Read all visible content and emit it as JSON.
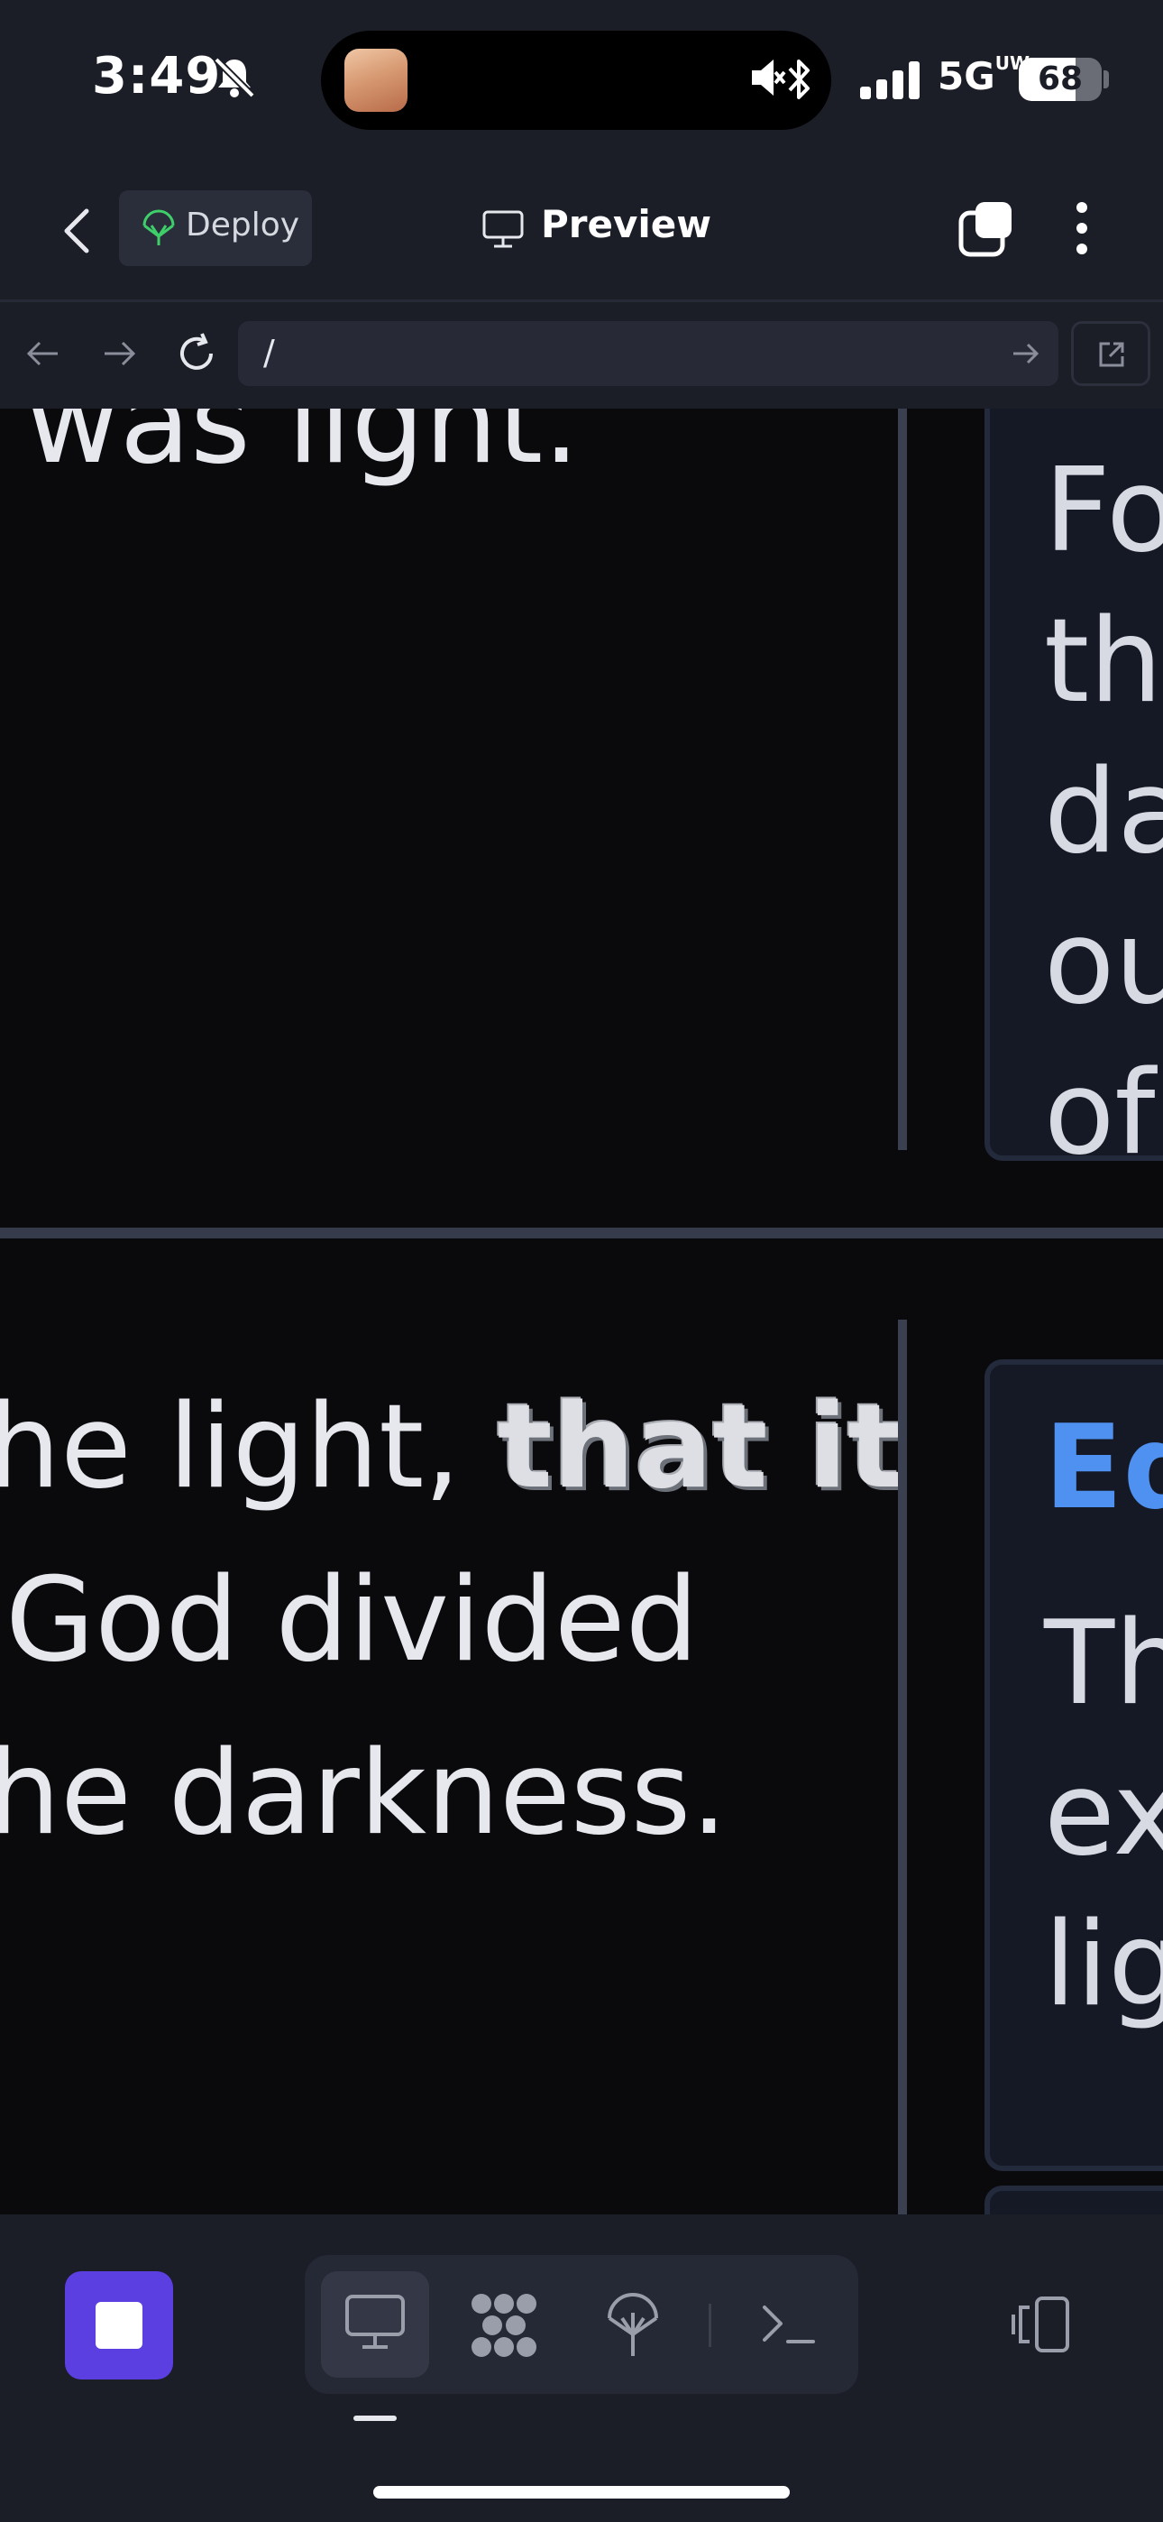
{
  "status_bar": {
    "time": "3:49",
    "network": "5G",
    "network_sub": "UW",
    "battery_percent": "68",
    "battery_level": 0.68,
    "icons": [
      "bell-slash-icon",
      "speaker-mute-icon",
      "bluetooth-icon",
      "signal-icon"
    ]
  },
  "header": {
    "back_icon": "chevron-left-icon",
    "deploy_label": "Deploy",
    "deploy_icon": "deploy-icon",
    "title": "Preview",
    "title_icon": "monitor-icon",
    "tabs_icon": "tabs-icon",
    "more_icon": "more-vertical-icon"
  },
  "browser": {
    "url": "/",
    "back_icon": "arrow-left-icon",
    "forward_icon": "arrow-right-icon",
    "reload_icon": "reload-icon",
    "go_icon": "arrow-right-icon",
    "open_external_icon": "external-link-icon"
  },
  "content": {
    "top_block": {
      "text_line": "was light."
    },
    "top_card": {
      "words": [
        "Fo",
        "the",
        "da",
        "ou",
        "of"
      ]
    },
    "bottom_block": {
      "line1_prefix": "he light, ",
      "line1_emphasis": "that it",
      "line2": "God divided",
      "line3": "he darkness."
    },
    "bottom_card": {
      "label": "Ed",
      "words": [
        "Th",
        "ex",
        "lig"
      ]
    }
  },
  "toolbar": {
    "stop_icon": "stop-icon",
    "preview_icon": "monitor-icon",
    "apps_icon": "apps-icon",
    "deploy_icon": "deploy-icon",
    "shell_icon": "terminal-icon",
    "devices_icon": "devices-icon",
    "accent_color": "#5b3fe0"
  },
  "colors": {
    "background": "#0a0a0d",
    "bar": "#1b1d27",
    "text": "#e6e8ee",
    "link_blue": "#4f91f0",
    "deploy_green": "#3ecf6a"
  }
}
